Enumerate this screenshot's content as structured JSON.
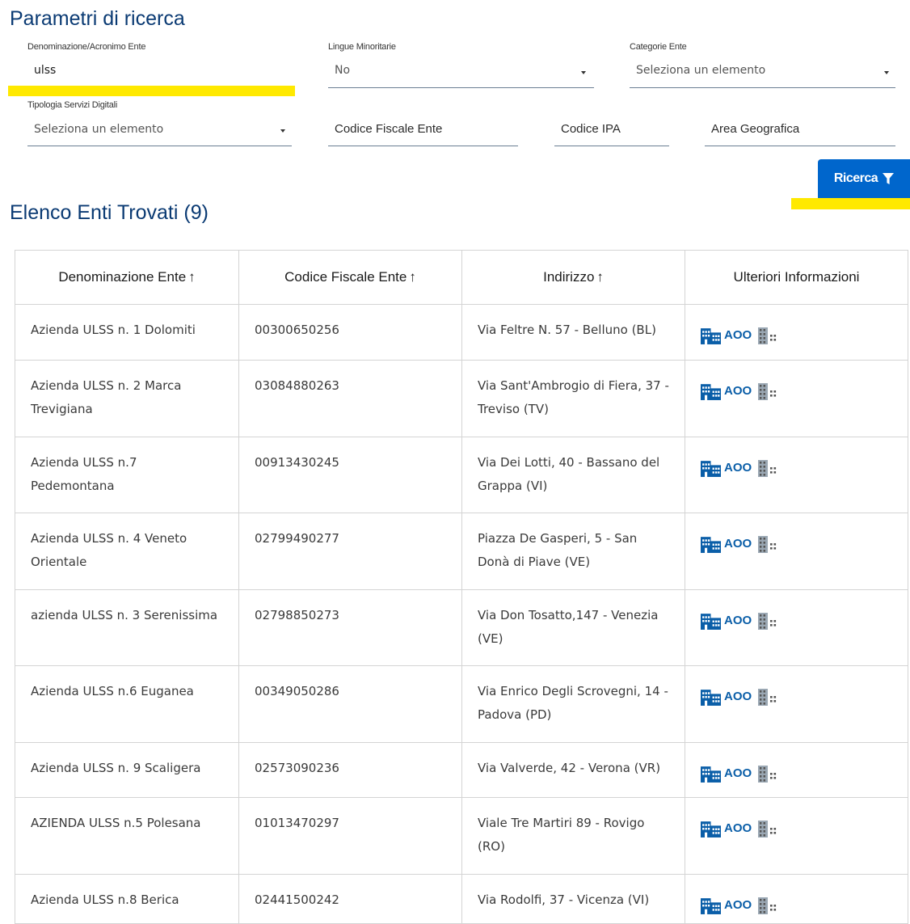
{
  "search": {
    "title": "Parametri di ricerca",
    "denominazione": {
      "label": "Denominazione/Acronimo Ente",
      "value": "ulss"
    },
    "lingue": {
      "label": "Lingue Minoritarie",
      "value": "No"
    },
    "categorie": {
      "label": "Categorie Ente",
      "value": "Seleziona un elemento"
    },
    "tipologia": {
      "label": "Tipologia Servizi Digitali",
      "value": "Seleziona un elemento"
    },
    "codice_fiscale": {
      "placeholder": "Codice Fiscale Ente"
    },
    "codice_ipa": {
      "placeholder": "Codice IPA"
    },
    "area_geografica": {
      "placeholder": "Area Geografica"
    },
    "button_label": "Ricerca",
    "accent_color": "#ffe900",
    "primary_color": "#0066cc"
  },
  "results": {
    "title": "Elenco Enti Trovati (9)",
    "columns": [
      "Denominazione Ente",
      "Codice Fiscale Ente",
      "Indirizzo",
      "Ulteriori Informazioni"
    ],
    "sort_icon": "arrow-up-icon",
    "rows": [
      {
        "denominazione": "Azienda ULSS n. 1 Dolomiti",
        "codice_fiscale": "00300650256",
        "indirizzo": "Via Feltre N. 57 - Belluno (BL)",
        "info": "AOO"
      },
      {
        "denominazione": "Azienda ULSS n. 2 Marca Trevigiana",
        "codice_fiscale": "03084880263",
        "indirizzo": "Via Sant'Ambrogio di Fiera, 37 - Treviso (TV)",
        "info": "AOO"
      },
      {
        "denominazione": "Azienda ULSS n.7 Pedemontana",
        "codice_fiscale": "00913430245",
        "indirizzo": "Via Dei Lotti, 40 - Bassano del Grappa (VI)",
        "info": "AOO"
      },
      {
        "denominazione": "Azienda ULSS n. 4 Veneto Orientale",
        "codice_fiscale": "02799490277",
        "indirizzo": "Piazza De Gasperi, 5 - San Donà di Piave (VE)",
        "info": "AOO"
      },
      {
        "denominazione": "azienda ULSS n. 3 Serenissima",
        "codice_fiscale": "02798850273",
        "indirizzo": "Via Don Tosatto,147 - Venezia (VE)",
        "info": "AOO"
      },
      {
        "denominazione": "Azienda ULSS n.6 Euganea",
        "codice_fiscale": "00349050286",
        "indirizzo": "Via Enrico Degli Scrovegni, 14 - Padova (PD)",
        "info": "AOO"
      },
      {
        "denominazione": "Azienda ULSS n. 9 Scaligera",
        "codice_fiscale": "02573090236",
        "indirizzo": "Via Valverde, 42 - Verona (VR)",
        "info": "AOO"
      },
      {
        "denominazione": "AZIENDA ULSS n.5 Polesana",
        "codice_fiscale": "01013470297",
        "indirizzo": "Viale Tre Martiri 89 - Rovigo (RO)",
        "info": "AOO"
      },
      {
        "denominazione": "Azienda ULSS n.8 Berica",
        "codice_fiscale": "02441500242",
        "indirizzo": "Via Rodolfi, 37 - Vicenza (VI)",
        "info": "AOO"
      }
    ],
    "icons": {
      "aoo": "building-icon",
      "uo": "building-grid-icon"
    }
  }
}
